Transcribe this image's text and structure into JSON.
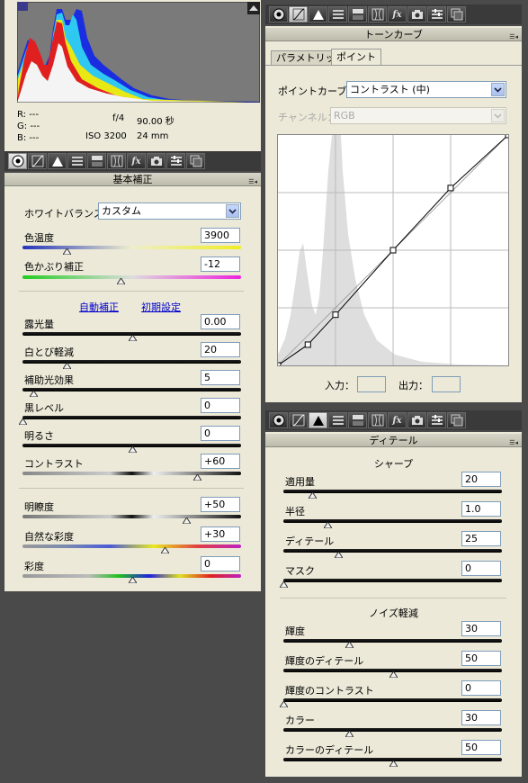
{
  "histogram": {
    "readout": {
      "r": "R:",
      "g": "G:",
      "b": "B:",
      "r_val": "---",
      "g_val": "---",
      "b_val": "---"
    },
    "aperture": "f/4",
    "shutter": "90.00 秒",
    "iso": "ISO 3200",
    "focal": "24 mm"
  },
  "left_panel": {
    "title": "基本補正",
    "wb_label": "ホワイトバランス：",
    "wb_value": "カスタム",
    "temp_label": "色温度",
    "temp_value": "3900",
    "tint_label": "色かぶり補正",
    "tint_value": "-12",
    "auto_link": "自動補正",
    "default_link": "初期設定",
    "exposure_label": "露光量",
    "exposure_value": "0.00",
    "recovery_label": "白とび軽減",
    "recovery_value": "20",
    "fill_label": "補助光効果",
    "fill_value": "5",
    "blacks_label": "黒レベル",
    "blacks_value": "0",
    "brightness_label": "明るさ",
    "brightness_value": "0",
    "contrast_label": "コントラスト",
    "contrast_value": "+60",
    "clarity_label": "明瞭度",
    "clarity_value": "+50",
    "vibrance_label": "自然な彩度",
    "vibrance_value": "+30",
    "saturation_label": "彩度",
    "saturation_value": "0"
  },
  "slider_levels": {
    "temp": 0.2,
    "tint": 0.45,
    "exposure": 0.5,
    "recovery": 0.2,
    "fill": 0.05,
    "blacks": 0.0,
    "brightness": 0.5,
    "contrast": 0.8,
    "clarity": 0.75,
    "vibrance": 0.65,
    "saturation": 0.5,
    "sharp_amount": 0.13,
    "sharp_radius": 0.2,
    "sharp_detail": 0.25,
    "sharp_mask": 0.0,
    "nr_lum": 0.3,
    "nr_lum_detail": 0.5,
    "nr_lum_contrast": 0.0,
    "nr_color": 0.3,
    "nr_color_detail": 0.5
  },
  "tone_curve": {
    "title": "トーンカーブ",
    "tab_parametric": "パラメトリック",
    "tab_point": "ポイント",
    "curve_label": "ポイントカーブ：",
    "curve_value": "コントラスト (中)",
    "channel_label": "チャンネル：",
    "channel_value": "RGB",
    "input_label": "入力：",
    "output_label": "出力：",
    "points": [
      [
        0,
        0
      ],
      [
        0.13,
        0.09
      ],
      [
        0.25,
        0.22
      ],
      [
        0.5,
        0.5
      ],
      [
        0.75,
        0.77
      ],
      [
        1,
        1
      ]
    ]
  },
  "detail_panel": {
    "title": "ディテール",
    "sharpen_heading": "シャープ",
    "amount_label": "適用量",
    "amount_value": "20",
    "radius_label": "半径",
    "radius_value": "1.0",
    "detail_label": "ディテール",
    "detail_value": "25",
    "mask_label": "マスク",
    "mask_value": "0",
    "nr_heading": "ノイズ軽減",
    "lum_label": "輝度",
    "lum_value": "30",
    "lum_detail_label": "輝度のディテール",
    "lum_detail_value": "50",
    "lum_contrast_label": "輝度のコントラスト",
    "lum_contrast_value": "0",
    "color_label": "カラー",
    "color_value": "30",
    "color_detail_label": "カラーのディテール",
    "color_detail_value": "50"
  },
  "toolbar_icons": [
    "aperture-icon",
    "tone-curve-icon",
    "detail-icon",
    "hsl-icon",
    "split-toning-icon",
    "lens-icon",
    "fx-icon",
    "camera-icon",
    "presets-icon",
    "snapshots-icon"
  ]
}
